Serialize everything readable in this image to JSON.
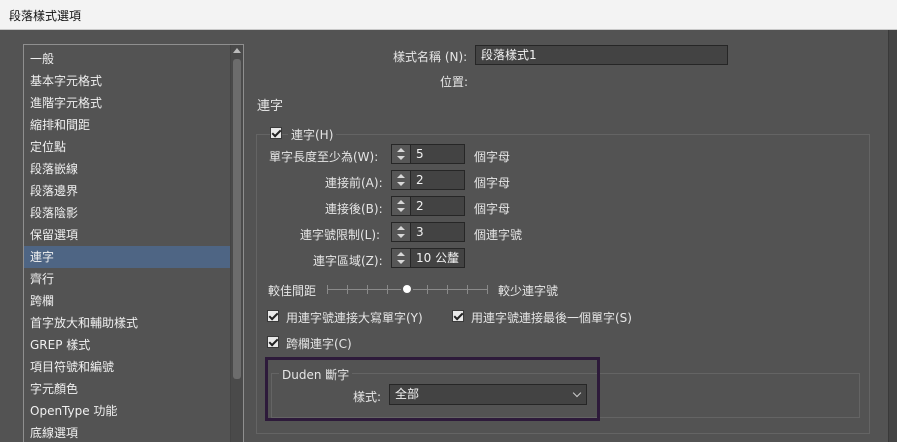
{
  "window": {
    "title": "段落樣式選項"
  },
  "sidebar": {
    "items": [
      {
        "label": "一般"
      },
      {
        "label": "基本字元格式"
      },
      {
        "label": "進階字元格式"
      },
      {
        "label": "縮排和間距"
      },
      {
        "label": "定位點"
      },
      {
        "label": "段落嵌線"
      },
      {
        "label": "段落邊界"
      },
      {
        "label": "段落陰影"
      },
      {
        "label": "保留選項"
      },
      {
        "label": "連字",
        "selected": true
      },
      {
        "label": "齊行"
      },
      {
        "label": "跨欄"
      },
      {
        "label": "首字放大和輔助樣式"
      },
      {
        "label": "GREP 樣式"
      },
      {
        "label": "項目符號和編號"
      },
      {
        "label": "字元顏色"
      },
      {
        "label": "OpenType 功能"
      },
      {
        "label": "底線選項"
      }
    ]
  },
  "header": {
    "style_name_label": "樣式名稱 (N):",
    "style_name_value": "段落樣式1",
    "location_label": "位置:",
    "section_title": "連字"
  },
  "hyphenation": {
    "enable_label": "連字(H)",
    "enabled": true,
    "fields": [
      {
        "label": "單字長度至少為(W):",
        "value": "5",
        "unit": "個字母"
      },
      {
        "label": "連接前(A):",
        "value": "2",
        "unit": "個字母"
      },
      {
        "label": "連接後(B):",
        "value": "2",
        "unit": "個字母"
      },
      {
        "label": "連字號限制(L):",
        "value": "3",
        "unit": "個連字號"
      },
      {
        "label": "連字區域(Z):",
        "value": "10 公釐",
        "unit": ""
      }
    ],
    "slider": {
      "left_label": "較佳間距",
      "right_label": "較少連字號",
      "value_fraction": 0.5
    },
    "option_capitalized": "用連字號連接大寫單字(Y)",
    "option_last_word": "用連字號連接最後一個單字(S)",
    "option_across_columns": "跨欄連字(C)"
  },
  "duden": {
    "group_title": "Duden 斷字",
    "style_label": "樣式:",
    "style_value": "全部"
  },
  "colors": {
    "selection": "#4e6584",
    "panel": "#535353",
    "highlight_border": "#2d1a3a"
  }
}
